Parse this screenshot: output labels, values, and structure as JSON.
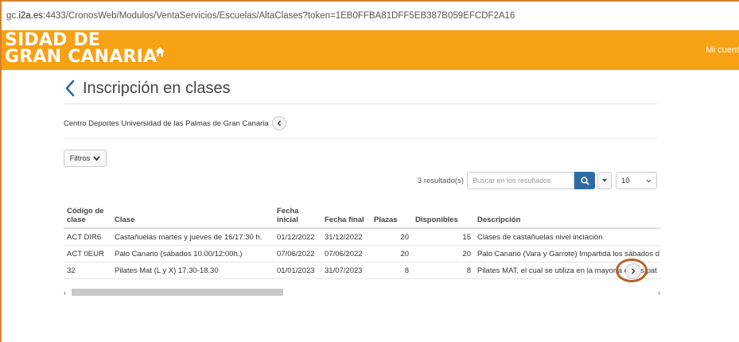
{
  "browser": {
    "url_prefix": "gc.",
    "url_host": "i2a.es",
    "url_path": ":4433/CronosWeb/Modulos/VentaServicios/Escuelas/AltaClases?token=1EB0FFBA81DFF5EB387B059EFCDF2A16"
  },
  "header": {
    "brand_line1": "SIDAD DE",
    "brand_line2": "GRAN CANARIA",
    "account": "Mi cuent",
    "brand_color": "#f7a114"
  },
  "page": {
    "title": "Inscripción en clases",
    "center": "Centro Deportes Universidad de las Palmas de Gran Canaria",
    "filters_label": "Filtros"
  },
  "toolbar": {
    "results": "3 resultado(s)",
    "search_placeholder": "Buscar en los resultados",
    "page_size": "10"
  },
  "table": {
    "headers": [
      "Código de clase",
      "Clase",
      "Fecha inicial",
      "Fecha final",
      "Plazas",
      "Disponibles",
      "Descripción"
    ],
    "rows": [
      [
        "ACT DIR6",
        "Castañuelas martes y jueves de 16/17:30 h.",
        "01/12/2022",
        "31/12/2022",
        "20",
        "15",
        "Clases de castañuelas nivel inciación"
      ],
      [
        "ACT 0EUR",
        "Palo Canario (sábados 10.00/12:00h.)",
        "07/06/2022",
        "07/06/2022",
        "20",
        "20",
        "Palo Canario (Vara y Garrote) Impartida los sábados d"
      ],
      [
        "32",
        "Pilates Mat (L y X) 17.30-18.30",
        "01/01/2023",
        "31/07/2023",
        "8",
        "8",
        "Pilates MAT, el cual se utiliza en la mayoría de las pat"
      ]
    ]
  },
  "icons": {
    "home": "home-icon",
    "back": "chevron-left-icon",
    "collapse": "chevron-left-icon",
    "search": "search-icon",
    "scroll_right": "chevron-right-icon"
  },
  "colors": {
    "header": "#f7a114",
    "accent": "#2d6ca2",
    "highlight": "#b5622a"
  }
}
